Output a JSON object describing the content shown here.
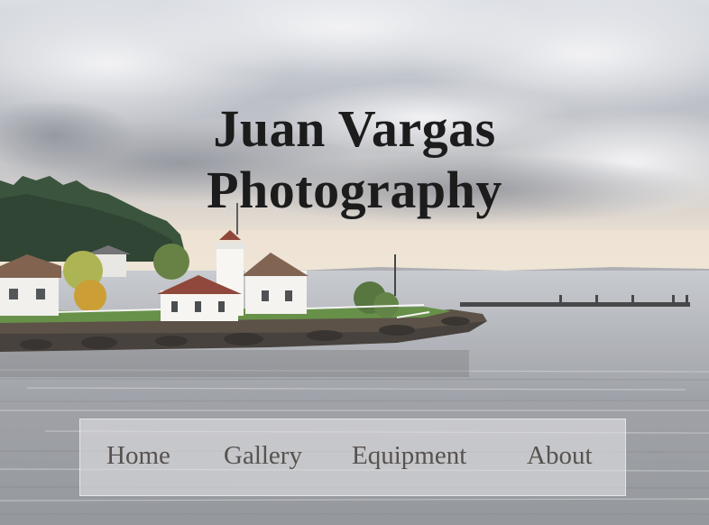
{
  "site": {
    "title_line1": "Juan Vargas",
    "title_line2": "Photography"
  },
  "nav": {
    "items": [
      {
        "label": "Home"
      },
      {
        "label": "Gallery"
      },
      {
        "label": "Equipment"
      },
      {
        "label": "About"
      }
    ]
  },
  "colors": {
    "title_text": "#1c1c1c",
    "nav_text": "#57524f",
    "nav_background": "#e1e1e4"
  }
}
